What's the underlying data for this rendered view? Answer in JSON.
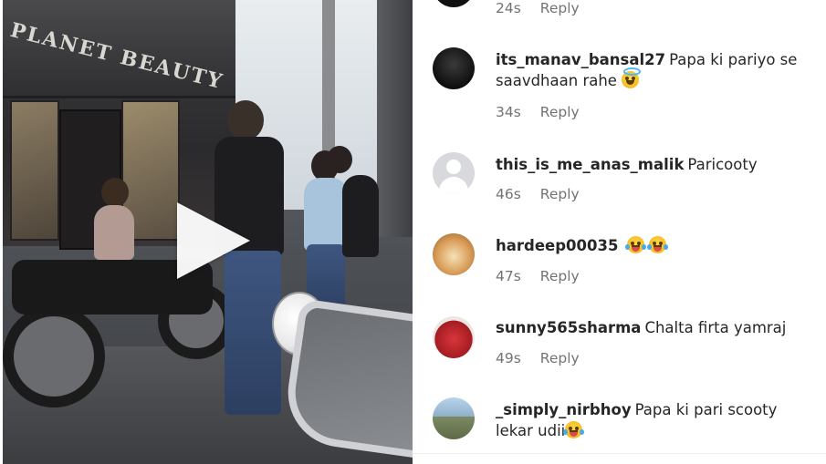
{
  "video": {
    "store_sign_text": "PLANET BEAUTY",
    "play_icon": "play-icon"
  },
  "comments": {
    "partial_top": {
      "time": "24s",
      "reply": "Reply"
    },
    "items": [
      {
        "username": "its_manav_bansal27",
        "text_line1": "Papa ki pariyo se",
        "text_line2": "saavdhaan rahe",
        "emoji": "smiling-face-with-halo",
        "time": "34s",
        "reply": "Reply"
      },
      {
        "username": "this_is_me_anas_malik",
        "text_line1": "Paricooty",
        "time": "46s",
        "reply": "Reply"
      },
      {
        "username": "hardeep00035",
        "text_line1": "",
        "emoji": "face-with-tears-of-joy x2",
        "time": "47s",
        "reply": "Reply"
      },
      {
        "username": "sunny565sharma",
        "text_line1": "Chalta firta yamraj",
        "time": "49s",
        "reply": "Reply"
      },
      {
        "username": "_simply_nirbhoy",
        "text_line1": "Papa ki pari scooty",
        "text_line2": "lekar udii",
        "emoji": "face-with-tears-of-joy",
        "time": "",
        "reply": ""
      }
    ]
  },
  "colors": {
    "username": "#262626",
    "meta": "#737373",
    "background": "#ffffff"
  }
}
